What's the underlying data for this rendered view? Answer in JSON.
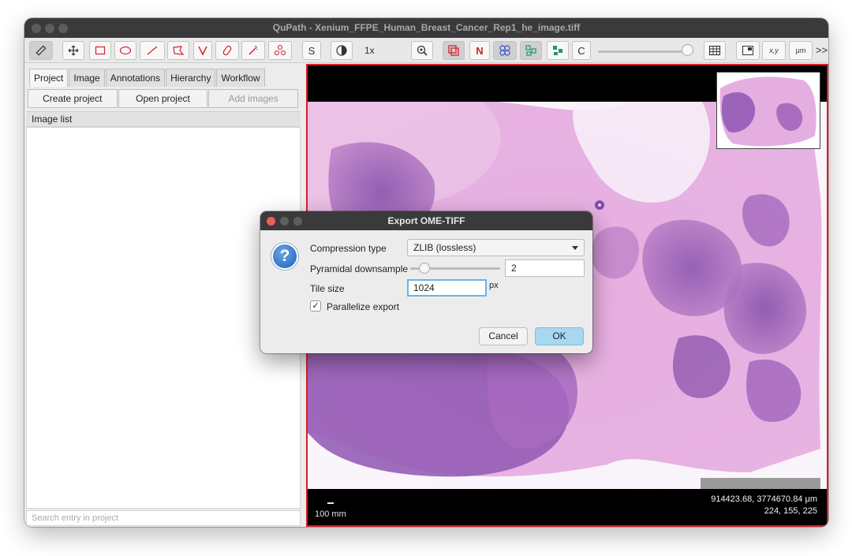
{
  "window": {
    "title": "QuPath - Xenium_FFPE_Human_Breast_Cancer_Rep1_he_image.tiff"
  },
  "toolbar": {
    "zoom_label": "1x",
    "tools": [
      "ruler-icon",
      "move-icon",
      "rectangle-icon",
      "ellipse-icon",
      "line-icon",
      "polygon-icon",
      "polyline-icon",
      "brush-icon",
      "wand-icon",
      "points-icon",
      "s-tool",
      "contrast-icon",
      "zoom-icon",
      "overlay-icon",
      "n-tool",
      "cells-icon",
      "detections-icon",
      "objects-icon",
      "c-tool",
      "grid-icon",
      "pixel-classifier-icon",
      "coords-icon",
      "scalebar-icon",
      "more-icon"
    ],
    "s_label": "S",
    "n_label": "N",
    "c_label": "C",
    "more_label": ">>",
    "xy_label": "x,y",
    "um_label": "μm",
    "accent_red": "#d5202a",
    "accent_cyan": "#8fd9d8"
  },
  "left_panel": {
    "tabs": [
      {
        "label": "Project",
        "active": true
      },
      {
        "label": "Image",
        "active": false
      },
      {
        "label": "Annotations",
        "active": false
      },
      {
        "label": "Hierarchy",
        "active": false
      },
      {
        "label": "Workflow",
        "active": false
      }
    ],
    "buttons": {
      "create": "Create project",
      "open": "Open project",
      "add_images": "Add images"
    },
    "image_list_header": "Image list",
    "search_placeholder": "Search entry in project"
  },
  "viewer": {
    "scalebar_label": "100 mm",
    "cursor_coords": "914423.68, 3774670.84 μm",
    "cursor_rgb": "224, 155, 225"
  },
  "dialog": {
    "title": "Export OME-TIFF",
    "compression_label": "Compression type",
    "compression_value": "ZLIB (lossless)",
    "downsample_label": "Pyramidal downsample",
    "downsample_value": "2",
    "tile_label": "Tile size",
    "tile_value": "1024",
    "tile_unit": "px",
    "parallelize_label": "Parallelize export",
    "parallelize_checked": true,
    "cancel_label": "Cancel",
    "ok_label": "OK",
    "check_glyph": "✓",
    "question_glyph": "?"
  }
}
